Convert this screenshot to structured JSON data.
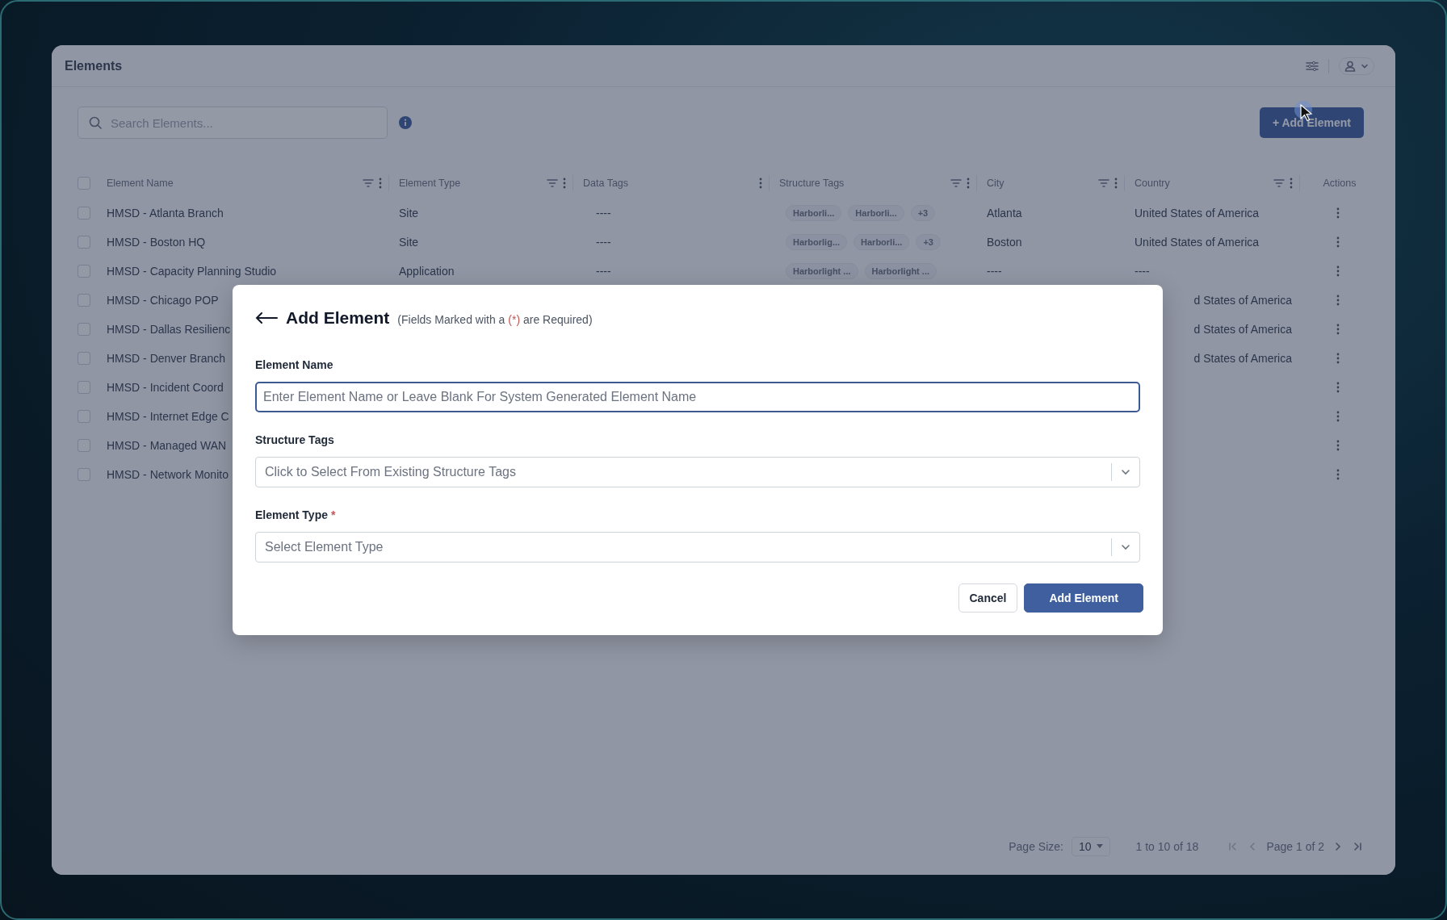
{
  "app": {
    "title": "Elements"
  },
  "toolbar": {
    "search": {
      "placeholder": "Search Elements..."
    },
    "add_button": "+ Add Element"
  },
  "table": {
    "select_all": {
      "checked": false
    },
    "columns": [
      {
        "label": "Element Name",
        "filter": true,
        "menu": true
      },
      {
        "label": "Element Type",
        "filter": true,
        "menu": true
      },
      {
        "label": "Data Tags",
        "filter": false,
        "menu": true
      },
      {
        "label": "Structure Tags",
        "filter": true,
        "menu": true
      },
      {
        "label": "City",
        "filter": true,
        "menu": true
      },
      {
        "label": "Country",
        "filter": true,
        "menu": true
      },
      {
        "label": "Actions",
        "filter": false,
        "menu": false
      }
    ],
    "rows": [
      {
        "checked": false,
        "name": "HMSD - Atlanta Branch",
        "type": "Site",
        "data_tags": "----",
        "structure_tags": [
          "Harborli...",
          "Harborli...",
          "+3"
        ],
        "city": "Atlanta",
        "country": "United States of America"
      },
      {
        "checked": false,
        "name": "HMSD - Boston HQ",
        "type": "Site",
        "data_tags": "----",
        "structure_tags": [
          "Harborlig...",
          "Harborli...",
          "+3"
        ],
        "city": "Boston",
        "country": "United States of America"
      },
      {
        "checked": false,
        "name": "HMSD - Capacity Planning Studio",
        "type": "Application",
        "data_tags": "----",
        "structure_tags": [
          "Harborlight ...",
          "Harborlight ..."
        ],
        "city": "----",
        "country": "----"
      },
      {
        "checked": false,
        "name": "HMSD - Chicago POP",
        "country": "d States of America",
        "country_cut": true
      },
      {
        "checked": false,
        "name": "HMSD - Dallas Resilienc",
        "country": "d States of America",
        "country_cut": true
      },
      {
        "checked": false,
        "name": "HMSD - Denver Branch",
        "country": "d States of America",
        "country_cut": true
      },
      {
        "checked": false,
        "name": "HMSD - Incident Coord"
      },
      {
        "checked": false,
        "name": "HMSD - Internet Edge C"
      },
      {
        "checked": false,
        "name": "HMSD - Managed WAN"
      },
      {
        "checked": false,
        "name": "HMSD - Network Monito"
      }
    ]
  },
  "pagination": {
    "page_size_label": "Page Size:",
    "page_size": "10",
    "range": "1 to 10 of 18",
    "page": "Page 1 of 2",
    "first_disabled": true,
    "prev_disabled": true,
    "next_disabled": false,
    "last_disabled": false
  },
  "modal": {
    "title": "Add Element",
    "note_before": "(Fields Marked with a ",
    "note_mark": "(*)",
    "note_after": " are Required)",
    "fields": [
      {
        "kind": "text",
        "label": "Element Name",
        "placeholder": "Enter Element Name or Leave Blank For System Generated Element Name",
        "focused": true
      },
      {
        "kind": "select",
        "label": "Structure Tags",
        "placeholder": "Click to Select From Existing Structure Tags",
        "focused": false
      },
      {
        "kind": "select",
        "label": "Element Type",
        "required_mark": "*",
        "placeholder": "Select Element Type",
        "focused": false
      }
    ],
    "buttons": [
      {
        "kind": "secondary",
        "label": "Cancel"
      },
      {
        "kind": "primary",
        "label": "Add Element"
      }
    ]
  }
}
